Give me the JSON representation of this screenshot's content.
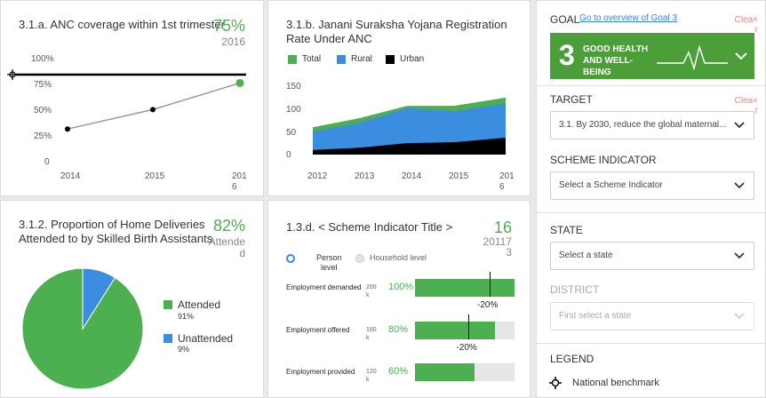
{
  "card1": {
    "title": "3.1.a. ANC coverage within 1st trimester",
    "value": "75%",
    "year": "2016",
    "chart_data": {
      "type": "line",
      "title": "3.1.a. ANC coverage within 1st trimester",
      "categories": [
        "2014",
        "2015",
        "2016"
      ],
      "x_tick_labels": [
        "2014",
        "2015",
        "201\n6"
      ],
      "series": [
        {
          "values": [
            32,
            51,
            77
          ]
        }
      ],
      "benchmark": 100,
      "y_ticks": [
        "100%",
        "75%",
        "50%",
        "25%",
        "0"
      ],
      "ylim": [
        0,
        100
      ]
    }
  },
  "card2": {
    "title_line1": "3.1.b. Janani Suraksha Yojana Registration",
    "title_line2": "Rate Under ANC",
    "chart_data": {
      "type": "area",
      "categories": [
        "2012",
        "2013",
        "2014",
        "2015",
        "2016"
      ],
      "x_tick_labels": [
        "2012",
        "2013",
        "2014",
        "2015",
        "201\n6"
      ],
      "series": [
        {
          "name": "Total",
          "values": [
            60,
            80,
            107,
            107,
            125
          ],
          "color": "#4caf50"
        },
        {
          "name": "Rural",
          "values": [
            50,
            70,
            102,
            95,
            112
          ],
          "color": "#3b8de0"
        },
        {
          "name": "Urban",
          "values": [
            10,
            15,
            25,
            27,
            37
          ],
          "color": "#000000"
        }
      ],
      "y_ticks": [
        "150",
        "100",
        "50",
        "0"
      ],
      "ylim": [
        0,
        150
      ]
    }
  },
  "card3": {
    "title_line1": "3.1.2. Proportion of Home Deliveries",
    "title_line2": "Attended to by Skilled Birth Assistants",
    "value": "82%",
    "value_sub1": "Attende",
    "value_sub2": "d",
    "chart_data": {
      "type": "pie",
      "slices": [
        {
          "name": "Attended",
          "value": 91,
          "label": "91%",
          "color": "#4caf50"
        },
        {
          "name": "Unattended",
          "value": 9,
          "label": "9%",
          "color": "#3b8de0"
        }
      ]
    }
  },
  "card4": {
    "title": "1.3.d. < Scheme Indicator Title >",
    "value": "16",
    "value_sub1": "2011",
    "value_sub2": "7",
    "value_sub3": "3",
    "radio_person_1": "Person",
    "radio_person_2": "level",
    "radio_household": "Household level",
    "chart_data": {
      "type": "bar",
      "rows": [
        {
          "label": "Employment demanded",
          "num1": "200",
          "num2": "k",
          "pct": "100%",
          "value": 100,
          "marker": 75,
          "marker_label": "-20%"
        },
        {
          "label": "Employment offered",
          "num1": "160",
          "num2": "k",
          "pct": "80%",
          "value": 80,
          "marker": 54,
          "marker_label": "-20%"
        },
        {
          "label": "Employment provided",
          "num1": "120",
          "num2": "k",
          "pct": "60%",
          "value": 60,
          "marker": null,
          "marker_label": ""
        }
      ]
    }
  },
  "panel": {
    "goal_label": "GOAL",
    "goal_link": "Go to overview of Goal 3",
    "clear1": "Clea×\nr",
    "goal_number": "3",
    "goal_name_1": "GOOD HEALTH",
    "goal_name_2": "AND WELL-BEING",
    "goal_color": "#4c9f38",
    "target_label": "TARGET",
    "clear2": "Clea×\nr",
    "target_value": "3.1. By 2030, reduce the global maternal...",
    "scheme_label": "SCHEME INDICATOR",
    "scheme_placeholder": "Select a Scheme Indicator",
    "state_label": "STATE",
    "state_placeholder": "Select a state",
    "district_label": "DISTRICT",
    "district_placeholder": "First select a state",
    "legend_label": "LEGEND",
    "legend_item": "National benchmark"
  }
}
